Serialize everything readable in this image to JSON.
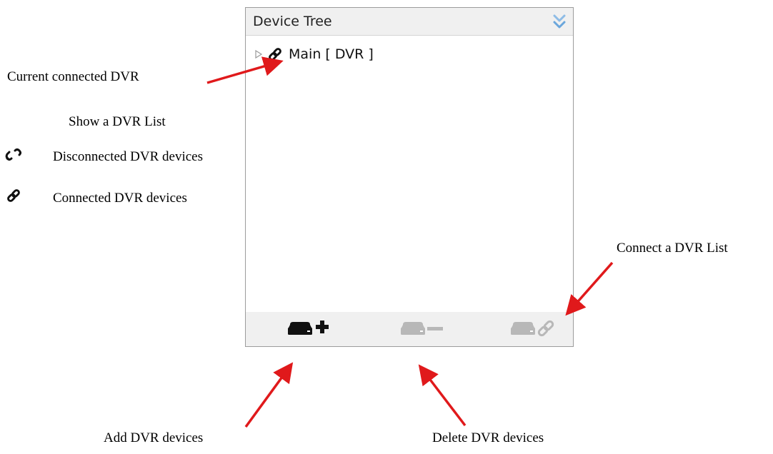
{
  "panel": {
    "title": "Device Tree",
    "tree": [
      {
        "label": "Main [ DVR ]",
        "status": "connected"
      }
    ],
    "toolbar": {
      "add": {
        "icon": "dvr-add-icon",
        "state": "enabled"
      },
      "delete": {
        "icon": "dvr-delete-icon",
        "state": "disabled"
      },
      "connect": {
        "icon": "dvr-connect-icon",
        "state": "disabled"
      }
    }
  },
  "annotations": {
    "current_connected": "Current connected DVR",
    "show_list": "Show a DVR List",
    "disconnected": "Disconnected DVR devices",
    "connected": "Connected DVR devices",
    "connect_list": "Connect a DVR List",
    "add_devices": "Add DVR devices",
    "delete_devices": "Delete DVR devices"
  },
  "colors": {
    "arrow": "#e0191b",
    "header_bg": "#f0f0f0",
    "border": "#9c9c9c",
    "collapse_icon": "#7fb3e0",
    "disabled_icon": "#b8b8b8"
  }
}
